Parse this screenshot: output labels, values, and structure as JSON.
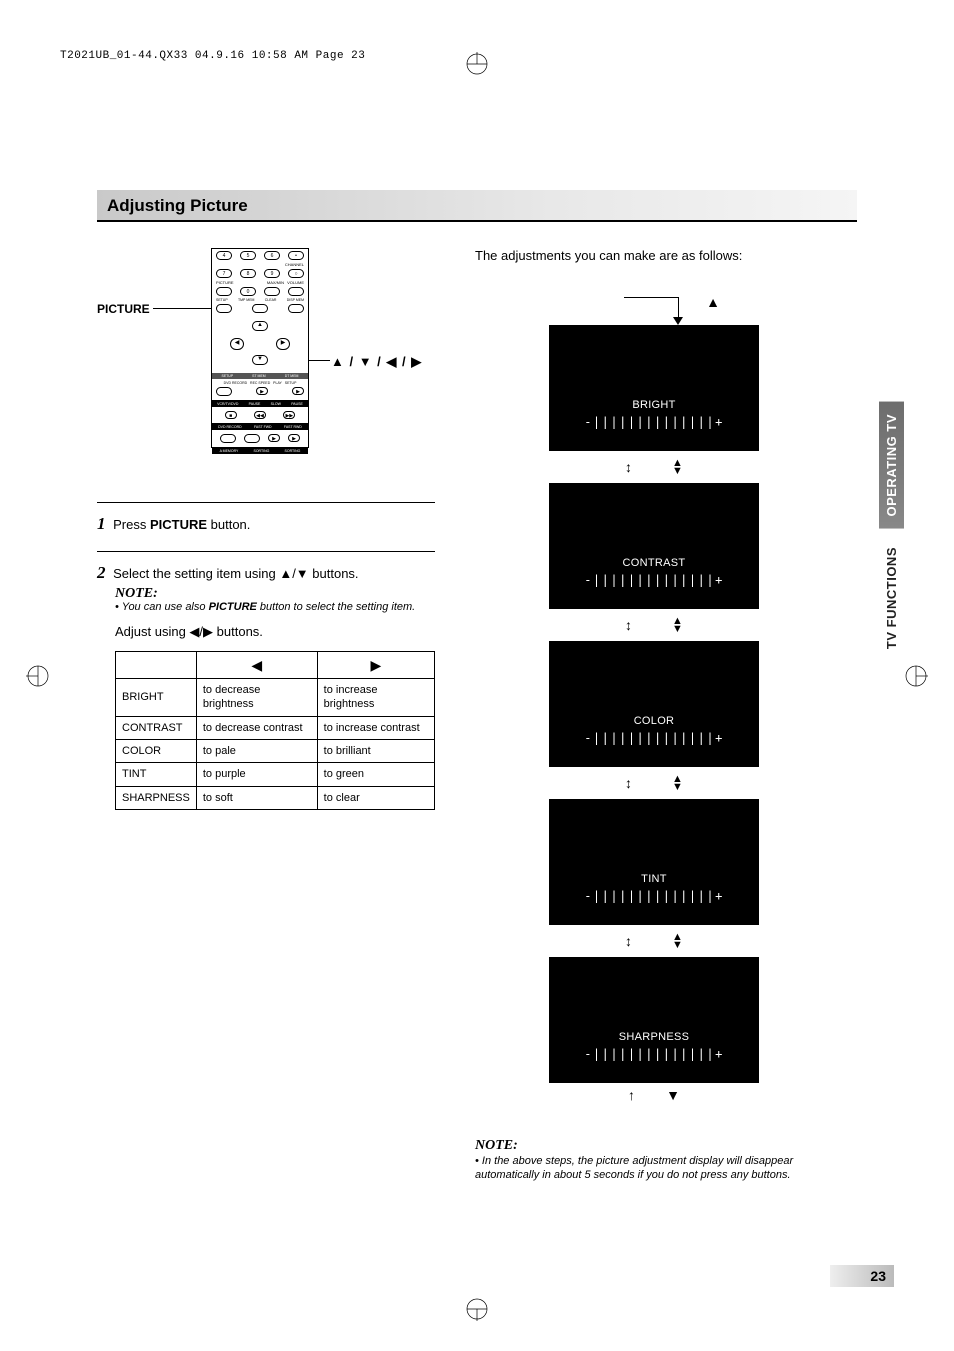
{
  "header_text": "T2021UB_01-44.QX33  04.9.16  10:58 AM  Page 23",
  "title": "Adjusting Picture",
  "picture_label": "PICTURE",
  "arrow_buttons_label": "▲ / ▼ / ◀ / ▶",
  "step1": {
    "num": "1",
    "prefix": "Press ",
    "bold": "PICTURE",
    "suffix": " button."
  },
  "step2": {
    "num": "2",
    "text": "Select the setting item using ▲/▼ buttons."
  },
  "note1": {
    "label": "NOTE:",
    "text": "• You can use also PICTURE button to select the setting item."
  },
  "adjust_using": "Adjust using ◀/▶ buttons.",
  "table": {
    "head_left": "◀",
    "head_right": "▶",
    "rows": [
      {
        "name": "BRIGHT",
        "left": "to decrease brightness",
        "right": "to increase brightness"
      },
      {
        "name": "CONTRAST",
        "left": "to decrease contrast",
        "right": "to increase contrast"
      },
      {
        "name": "COLOR",
        "left": "to pale",
        "right": "to brilliant"
      },
      {
        "name": "TINT",
        "left": "to purple",
        "right": "to green"
      },
      {
        "name": "SHARPNESS",
        "left": "to soft",
        "right": "to clear"
      }
    ]
  },
  "intro_right": "The adjustments you can make are as follows:",
  "panels": [
    {
      "label": "BRIGHT",
      "bar": "-||||||||||||||+"
    },
    {
      "label": "CONTRAST",
      "bar": "-||||||||||||||+"
    },
    {
      "label": "COLOR",
      "bar": "-||||||||||||||+"
    },
    {
      "label": "TINT",
      "bar": "-||||||||||||||+"
    },
    {
      "label": "SHARPNESS",
      "bar": "-||||||||||||||+"
    }
  ],
  "note2": {
    "label": "NOTE:",
    "text": "• In the above steps, the picture adjustment display will disappear automatically in about 5 seconds if you do not press any buttons."
  },
  "side_tabs": {
    "top": "OPERATING TV",
    "bottom": "TV FUNCTIONS"
  },
  "page_number": "23",
  "remote": {
    "row1": [
      "4",
      "5",
      "6",
      "•"
    ],
    "row1_side": "CHANNEL",
    "row2": [
      "7",
      "8",
      "9",
      "○"
    ],
    "row2_lbl": "PICTURE",
    "row2_side": "MAX/MIN VOLUME",
    "row3": [
      "",
      "0",
      "",
      ""
    ],
    "row3_lbls": [
      "SETUP",
      "TMP MEM",
      "CLEAR",
      "DISP MEM"
    ],
    "strip1": [
      "SETUP",
      "ST MEM",
      "DT MEM"
    ],
    "strip2": [
      "DVD RECORD  REC SPEED  PLAY  SETUP"
    ],
    "strip3": [
      "VCR/TV/DVD  PAUSE  SLOW  PAUSE"
    ],
    "strip5": [
      "DVD RECORD  FAST FWD  FAST RWD"
    ],
    "strip6": [
      "A MEMORY  SORTING  SORTING"
    ]
  }
}
